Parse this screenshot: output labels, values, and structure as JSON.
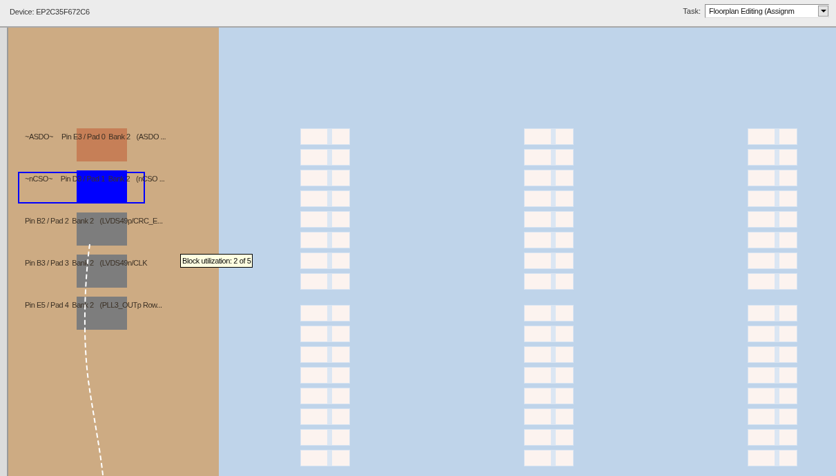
{
  "toolbar": {
    "device_label": "Device: EP2C35F672C6",
    "task_label": "Task:",
    "task_value": "Floorplan Editing (Assignm"
  },
  "pins": [
    {
      "prefix": "~ASDO~",
      "pin": "Pin E3 / Pad 0",
      "bank": "Bank 2",
      "function": "(ASDO ...",
      "color": "#c67f57",
      "selected": false
    },
    {
      "prefix": "~nCSO~",
      "pin": "Pin D3 / Pad 1",
      "bank": "Bank 2",
      "function": "(nCSO ...",
      "color": "#0000ff",
      "selected": true
    },
    {
      "pin": "Pin B2 / Pad 2",
      "bank": "Bank 2",
      "function": "(LVDS49p/CRC_E...",
      "color": "#7d7d7d",
      "selected": false
    },
    {
      "pin": "Pin B3 / Pad 3",
      "bank": "Bank 2",
      "function": "(LVDS49n/CLK",
      "color": "#7d7d7d",
      "selected": false
    },
    {
      "pin": "Pin E5 / Pad 4",
      "bank": "Bank 2",
      "function": "(PLL3_OUTp  Row...",
      "color": "#7d7d7d",
      "selected": false
    }
  ],
  "tooltip": "Block utilization: 2 of 5"
}
